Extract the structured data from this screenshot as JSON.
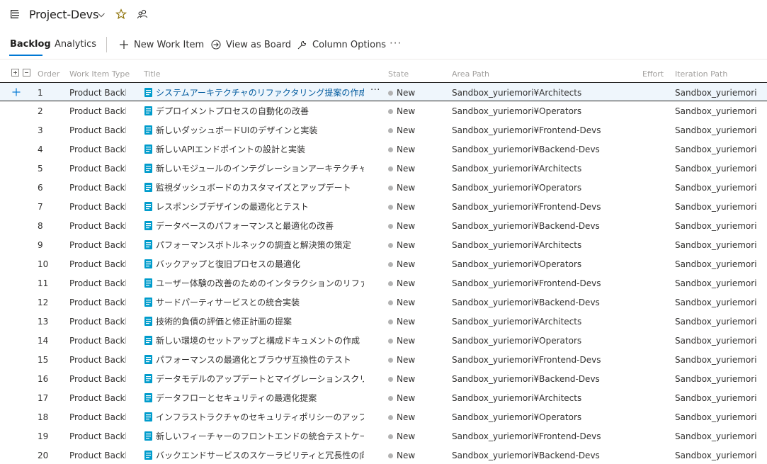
{
  "header": {
    "project_name": "Project-Devs"
  },
  "toolbar": {
    "tabs": [
      {
        "label": "Backlog",
        "active": true
      },
      {
        "label": "Analytics",
        "active": false
      }
    ],
    "new_work_item": "New Work Item",
    "view_as_board": "View as Board",
    "column_options": "Column Options",
    "more": "···"
  },
  "columns": {
    "order": "Order",
    "type": "Work Item Type",
    "title": "Title",
    "state": "State",
    "area": "Area Path",
    "effort": "Effort",
    "iteration": "Iteration Path"
  },
  "colors": {
    "accent": "#0078d4",
    "work_item_icon": "#009ccc",
    "state_new": "#b2b2b2",
    "selected_row": "#eff6fc"
  },
  "rows": [
    {
      "order": "1",
      "type": "Product Backl...",
      "title": "システムアーキテクチャのリファクタリング提案の作成",
      "state": "New",
      "area": "Sandbox_yuriemori¥Architects",
      "iteration": "Sandbox_yuriemori"
    },
    {
      "order": "2",
      "type": "Product Backl...",
      "title": "デプロイメントプロセスの自動化の改善",
      "state": "New",
      "area": "Sandbox_yuriemori¥Operators",
      "iteration": "Sandbox_yuriemori"
    },
    {
      "order": "3",
      "type": "Product Backl...",
      "title": "新しいダッシュボードUIのデザインと実装",
      "state": "New",
      "area": "Sandbox_yuriemori¥Frontend-Devs",
      "iteration": "Sandbox_yuriemori"
    },
    {
      "order": "4",
      "type": "Product Backl...",
      "title": "新しいAPIエンドポイントの設計と実装",
      "state": "New",
      "area": "Sandbox_yuriemori¥Backend-Devs",
      "iteration": "Sandbox_yuriemori"
    },
    {
      "order": "5",
      "type": "Product Backl...",
      "title": "新しいモジュールのインテグレーションアーキテクチャの設計",
      "state": "New",
      "area": "Sandbox_yuriemori¥Architects",
      "iteration": "Sandbox_yuriemori"
    },
    {
      "order": "6",
      "type": "Product Backl...",
      "title": "監視ダッシュボードのカスタマイズとアップデート",
      "state": "New",
      "area": "Sandbox_yuriemori¥Operators",
      "iteration": "Sandbox_yuriemori"
    },
    {
      "order": "7",
      "type": "Product Backl...",
      "title": "レスポンシブデザインの最適化とテスト",
      "state": "New",
      "area": "Sandbox_yuriemori¥Frontend-Devs",
      "iteration": "Sandbox_yuriemori"
    },
    {
      "order": "8",
      "type": "Product Backl...",
      "title": "データベースのパフォーマンスと最適化の改善",
      "state": "New",
      "area": "Sandbox_yuriemori¥Backend-Devs",
      "iteration": "Sandbox_yuriemori"
    },
    {
      "order": "9",
      "type": "Product Backl...",
      "title": "パフォーマンスボトルネックの調査と解決策の策定",
      "state": "New",
      "area": "Sandbox_yuriemori¥Architects",
      "iteration": "Sandbox_yuriemori"
    },
    {
      "order": "10",
      "type": "Product Backl...",
      "title": "バックアップと復旧プロセスの最適化",
      "state": "New",
      "area": "Sandbox_yuriemori¥Operators",
      "iteration": "Sandbox_yuriemori"
    },
    {
      "order": "11",
      "type": "Product Backl...",
      "title": "ユーザー体験の改善のためのインタラクションのリファクタリング",
      "state": "New",
      "area": "Sandbox_yuriemori¥Frontend-Devs",
      "iteration": "Sandbox_yuriemori"
    },
    {
      "order": "12",
      "type": "Product Backl...",
      "title": "サードパーティサービスとの統合実装",
      "state": "New",
      "area": "Sandbox_yuriemori¥Backend-Devs",
      "iteration": "Sandbox_yuriemori"
    },
    {
      "order": "13",
      "type": "Product Backl...",
      "title": "技術的負債の評価と修正計画の提案",
      "state": "New",
      "area": "Sandbox_yuriemori¥Architects",
      "iteration": "Sandbox_yuriemori"
    },
    {
      "order": "14",
      "type": "Product Backl...",
      "title": "新しい環境のセットアップと構成ドキュメントの作成",
      "state": "New",
      "area": "Sandbox_yuriemori¥Operators",
      "iteration": "Sandbox_yuriemori"
    },
    {
      "order": "15",
      "type": "Product Backl...",
      "title": "パフォーマンスの最適化とブラウザ互換性のテスト",
      "state": "New",
      "area": "Sandbox_yuriemori¥Frontend-Devs",
      "iteration": "Sandbox_yuriemori"
    },
    {
      "order": "16",
      "type": "Product Backl...",
      "title": "データモデルのアップデートとマイグレーションスクリプトの作成",
      "state": "New",
      "area": "Sandbox_yuriemori¥Backend-Devs",
      "iteration": "Sandbox_yuriemori"
    },
    {
      "order": "17",
      "type": "Product Backl...",
      "title": "データフローとセキュリティの最適化提案",
      "state": "New",
      "area": "Sandbox_yuriemori¥Architects",
      "iteration": "Sandbox_yuriemori"
    },
    {
      "order": "18",
      "type": "Product Backl...",
      "title": "インフラストラクチャのセキュリティポリシーのアップデート",
      "state": "New",
      "area": "Sandbox_yuriemori¥Operators",
      "iteration": "Sandbox_yuriemori"
    },
    {
      "order": "19",
      "type": "Product Backl...",
      "title": "新しいフィーチャーのフロントエンドの統合テストケースの作成",
      "state": "New",
      "area": "Sandbox_yuriemori¥Frontend-Devs",
      "iteration": "Sandbox_yuriemori"
    },
    {
      "order": "20",
      "type": "Product Backl...",
      "title": "バックエンドサービスのスケーラビリティと冗長性の向上策の提案",
      "state": "New",
      "area": "Sandbox_yuriemori¥Backend-Devs",
      "iteration": "Sandbox_yuriemori"
    }
  ],
  "row_more": "···"
}
